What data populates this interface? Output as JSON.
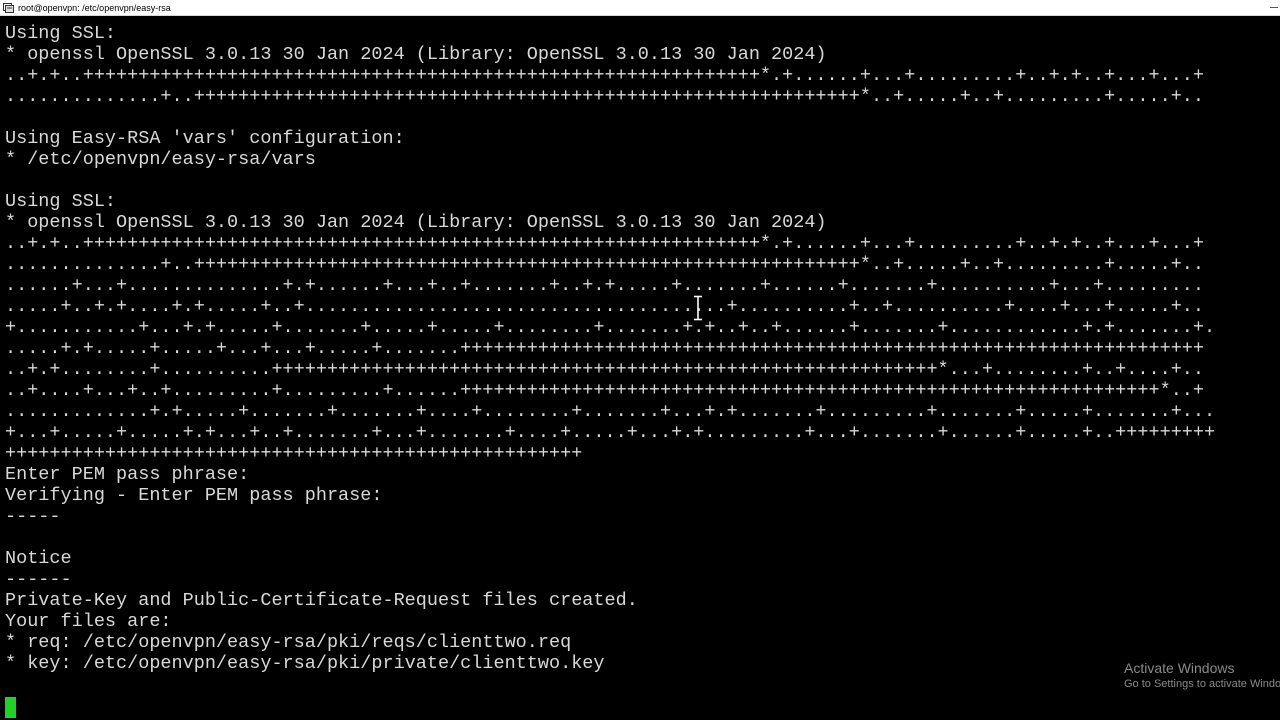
{
  "window": {
    "title": "root@openvpn: /etc/openvpn/easy-rsa",
    "icon": "terminal-app-icon"
  },
  "terminal": {
    "lines": [
      "Using SSL:",
      "* openssl OpenSSL 3.0.13 30 Jan 2024 (Library: OpenSSL 3.0.13 30 Jan 2024)",
      "..+.+..+++++++++++++++++++++++++++++++++++++++++++++++++++++++++++++*.+......+...+.........+..+.+..+...+...+",
      "..............+..++++++++++++++++++++++++++++++++++++++++++++++++++++++++++++*..+.....+..+.........+.....+..",
      "",
      "Using Easy-RSA 'vars' configuration:",
      "* /etc/openvpn/easy-rsa/vars",
      "",
      "Using SSL:",
      "* openssl OpenSSL 3.0.13 30 Jan 2024 (Library: OpenSSL 3.0.13 30 Jan 2024)",
      "..+.+..+++++++++++++++++++++++++++++++++++++++++++++++++++++++++++++*.+......+...+.........+..+.+..+...+...+",
      "..............+..++++++++++++++++++++++++++++++++++++++++++++++++++++++++++++*..+.....+..+.........+.....+..",
      "......+...+..............+.+......+...+..+.......+..+.+.....+.......+......+.......+..........+...+.........",
      ".....+..+.+....+.+.....+..+......................................+..........+..+..........+....+...+.....+..",
      "+...........+...+.+.....+.......+.....+.....+........+.......+.+..+..+......+.......+............+.+.......+.",
      ".....+.+.....+.....+...+...+.....+.......+++++++++++++++++++++++++++++++++++++++++++++++++++++++++++++++++++",
      "..+.+........+..........++++++++++++++++++++++++++++++++++++++++++++++++++++++++++++*...+........+..+....+..",
      "..+....+...+..+.........+.........+......+++++++++++++++++++++++++++++++++++++++++++++++++++++++++++++++*..+",
      ".............+.+.....+.......+.......+....+........+.......+...+.+.......+.........+.......+.....+.......+...",
      "+...+.....+.....+.+...+..+.......+...+.......+....+.....+...+.+.........+...+.......+......+.....+..+++++++++",
      "++++++++++++++++++++++++++++++++++++++++++++++++++++",
      "Enter PEM pass phrase:",
      "Verifying - Enter PEM pass phrase:",
      "-----",
      "",
      "Notice",
      "------",
      "Private-Key and Public-Certificate-Request files created.",
      "Your files are:",
      "* req: /etc/openvpn/easy-rsa/pki/reqs/clienttwo.req",
      "* key: /etc/openvpn/easy-rsa/pki/private/clienttwo.key",
      "",
      ""
    ],
    "cursor_color": "#1ed321",
    "text_color": "#d8d8d8",
    "background": "#000000"
  },
  "watermark": {
    "title": "Activate Windows",
    "subtitle": "Go to Settings to activate Windows"
  },
  "icons": {
    "mouse_pointer": "text-ibeam-cursor-icon"
  }
}
